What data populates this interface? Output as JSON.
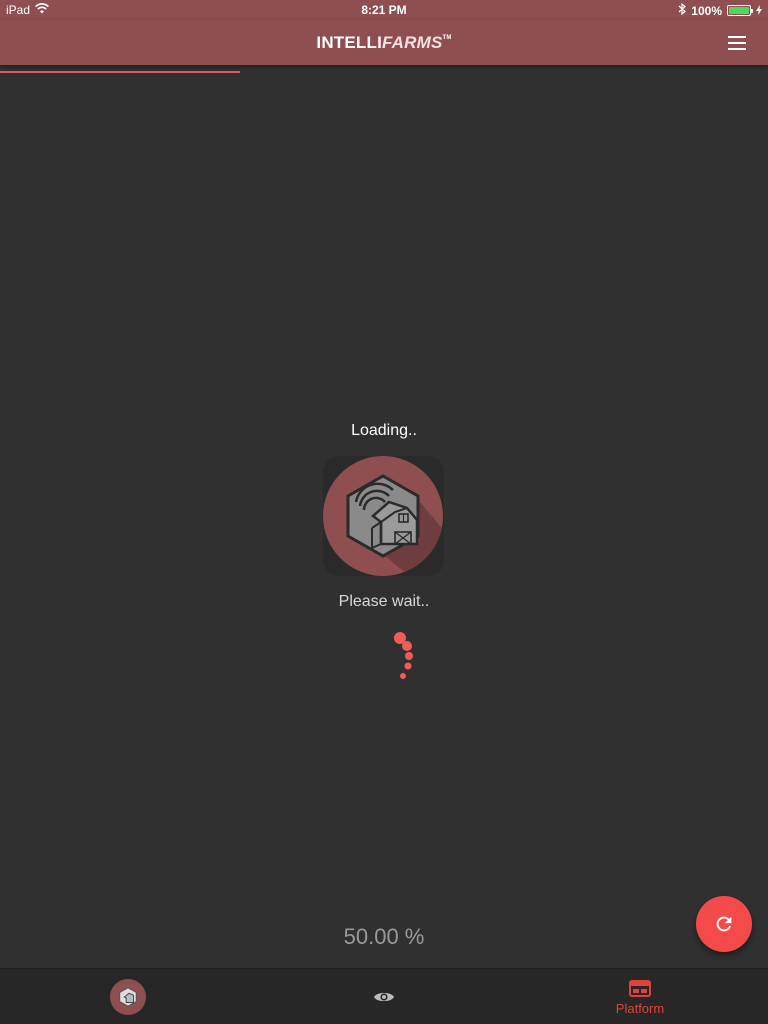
{
  "status_bar": {
    "device": "iPad",
    "time": "8:21 PM",
    "battery": "100%",
    "battery_level": 1.0
  },
  "header": {
    "brand_part1": "INTELLI",
    "brand_part2": "FARMS",
    "brand_tm": "TM",
    "menu_icon": "hamburger-menu-icon"
  },
  "top_progress": {
    "value": 0.3125,
    "color": "#e05a55"
  },
  "loader": {
    "title": "Loading..",
    "subtitle": "Please wait..",
    "percent_text": "50.00 %",
    "spinner_color": "#f25c58"
  },
  "fab": {
    "icon": "refresh-icon",
    "color": "#f44b4a"
  },
  "bottom_nav": {
    "items": [
      {
        "icon": "farm-avatar-icon",
        "label": ""
      },
      {
        "icon": "eye-icon",
        "label": ""
      },
      {
        "icon": "platform-icon",
        "label": "Platform"
      }
    ],
    "active_color": "#e0413c"
  },
  "colors": {
    "primary": "#8f4e50",
    "background": "#303030",
    "accent": "#f44b4a"
  }
}
